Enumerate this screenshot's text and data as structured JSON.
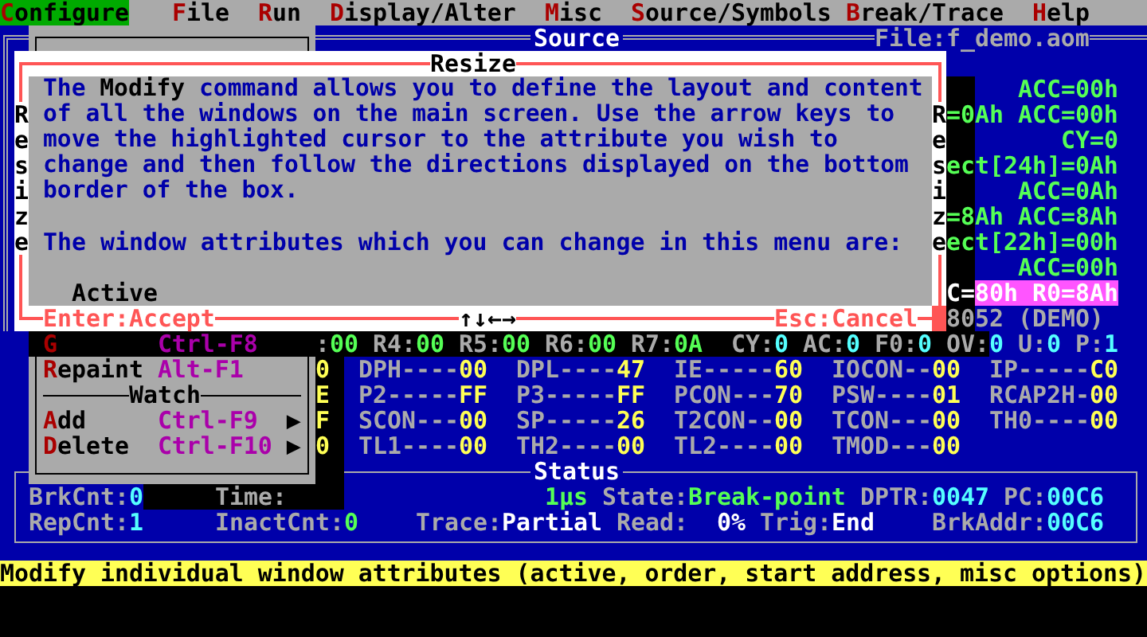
{
  "menu_bar": [
    {
      "label": "Configure",
      "selected": true
    },
    {
      "label": "File",
      "selected": false
    },
    {
      "label": "Run",
      "selected": false
    },
    {
      "label": "Display/Alter",
      "selected": false
    },
    {
      "label": "Misc",
      "selected": false
    },
    {
      "label": "Source/Symbols",
      "selected": false
    },
    {
      "label": "Break/Trace",
      "selected": false
    },
    {
      "label": "Help",
      "selected": false
    }
  ],
  "source_window": {
    "title": "Source",
    "file": "File:f_demo.aom",
    "lines": [
      "ACC=00h",
      "=0Ah ACC=00h",
      "CY=0",
      "ect[24h]=0Ah",
      "ACC=0Ah",
      "=8Ah ACC=8Ah",
      "ect[22h]=00h",
      "ACC=00h"
    ],
    "current_line": {
      "prefix": "C=",
      "highlight": "80h R0=8Ah"
    },
    "processor": "8052 (DEMO)"
  },
  "dialog": {
    "title": "Resize",
    "description": "The **Modify** command allows you to define the layout and content of all the windows on the main screen. Use the arrow keys to move the highlighted cursor to the attribute you wish to change and then follow the directions displayed on the bottom border of the box.",
    "attributes_intro": "The window attributes which you can change in this menu are:",
    "attributes": [
      "Active"
    ],
    "side_label_left": "Resize",
    "side_label_right": "Resize",
    "accept_hint": "Enter:Accept",
    "keys_hint": "↑↓←→",
    "cancel_hint": "Esc:Cancel"
  },
  "popup_menu": {
    "items": [
      {
        "kind": "item",
        "label": "G",
        "shortcut": "Ctrl-F8"
      },
      {
        "kind": "item",
        "label": "Repaint",
        "shortcut": "Alt-F1"
      },
      {
        "kind": "separator",
        "label": "Watch"
      },
      {
        "kind": "item",
        "label": "Add",
        "shortcut": "Ctrl-F9",
        "submenu_arrow": "▶"
      },
      {
        "kind": "item",
        "label": "Delete",
        "shortcut": "Ctrl-F10",
        "submenu_arrow": "▶"
      }
    ]
  },
  "registers": {
    "bank": [
      {
        "label": ":",
        "value": "00"
      },
      {
        "label": "R4:",
        "value": "00"
      },
      {
        "label": "R5:",
        "value": "00"
      },
      {
        "label": "R6:",
        "value": "00"
      },
      {
        "label": "R7:",
        "value": "0A"
      }
    ],
    "flags": [
      {
        "label": "CY:",
        "value": "0"
      },
      {
        "label": "AC:",
        "value": "0"
      },
      {
        "label": "F0:",
        "value": "0"
      },
      {
        "label": "OV:",
        "value": "0"
      },
      {
        "label": "U:",
        "value": "0"
      },
      {
        "label": "P:",
        "value": "1"
      }
    ],
    "sfr_rows": [
      {
        "cut_value": "0",
        "cells": [
          {
            "name": "DPH----",
            "value": "00"
          },
          {
            "name": "DPL----",
            "value": "47"
          },
          {
            "name": "IE-----",
            "value": "60"
          },
          {
            "name": "IOCON--",
            "value": "00"
          },
          {
            "name": "IP-----",
            "value": "C0"
          }
        ]
      },
      {
        "cut_value": "E",
        "cells": [
          {
            "name": "P2-----",
            "value": "FF"
          },
          {
            "name": "P3-----",
            "value": "FF"
          },
          {
            "name": "PCON---",
            "value": "70"
          },
          {
            "name": "PSW----",
            "value": "01"
          },
          {
            "name": "RCAP2H-",
            "value": "00"
          }
        ]
      },
      {
        "cut_value": "F",
        "cells": [
          {
            "name": "SCON---",
            "value": "00"
          },
          {
            "name": "SP-----",
            "value": "26"
          },
          {
            "name": "T2CON--",
            "value": "00"
          },
          {
            "name": "TCON---",
            "value": "00"
          },
          {
            "name": "TH0----",
            "value": "00"
          }
        ]
      },
      {
        "cut_value": "0",
        "cells": [
          {
            "name": "TL1----",
            "value": "00"
          },
          {
            "name": "TH2----",
            "value": "00"
          },
          {
            "name": "TL2----",
            "value": "00"
          },
          {
            "name": "TMOD---",
            "value": "00"
          }
        ]
      }
    ]
  },
  "status_window": {
    "title": "Status",
    "rows": [
      {
        "fields": [
          {
            "label": "BrkCnt:",
            "value": "0",
            "color": "#55ffff"
          },
          {
            "label": "Time:",
            "value": "1µs",
            "color": "#55ff55"
          },
          {
            "label": "State:",
            "value": "Break-point",
            "color": "#55ff55"
          },
          {
            "label": "DPTR:",
            "value": "0047",
            "color": "#55ffff"
          },
          {
            "label": "PC:",
            "value": "00C6",
            "color": "#55ffff"
          }
        ]
      },
      {
        "fields": [
          {
            "label": "RepCnt:",
            "value": "1",
            "color": "#55ffff"
          },
          {
            "label": "InactCnt:",
            "value": "0",
            "color": "#55ff55"
          },
          {
            "label": "Trace:",
            "value": "Partial",
            "color": "#ffffff"
          },
          {
            "label": "Read:",
            "value": "0%",
            "color": "#ffffff"
          },
          {
            "label": "Trig:",
            "value": "End",
            "color": "#ffffff"
          },
          {
            "label": "BrkAddr:",
            "value": "00C6",
            "color": "#55ffff"
          }
        ]
      }
    ]
  },
  "status_line": "Modify individual window attributes (active, order, start address, misc options)"
}
